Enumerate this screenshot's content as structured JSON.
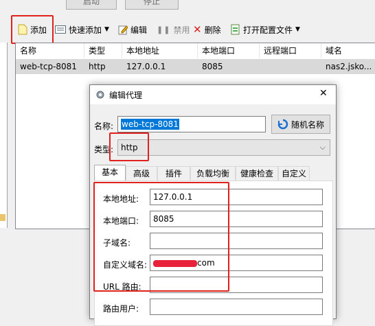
{
  "top_buttons": {
    "start": "启动",
    "stop": "停止"
  },
  "toolbar": {
    "add": "添加",
    "quick_add": "快速添加",
    "edit": "编辑",
    "disable": "禁用",
    "delete": "删除",
    "open_config": "打开配置文件"
  },
  "table": {
    "columns": [
      "名称",
      "类型",
      "本地地址",
      "本地端口",
      "远程端口",
      "域名"
    ],
    "rows": [
      {
        "name": "web-tcp-8081",
        "type": "http",
        "local_addr": "127.0.0.1",
        "local_port": "8085",
        "remote_port": "",
        "domain": "nas2.jsko..."
      }
    ]
  },
  "dialog": {
    "title": "编辑代理",
    "close": "✕",
    "name_label": "名称:",
    "name_value": "web-tcp-8081",
    "random_name_button": "随机名称",
    "type_label": "类型:",
    "type_value": "http",
    "tabs": [
      "基本",
      "高级",
      "插件",
      "负载均衡",
      "健康检查",
      "自定义"
    ],
    "fields": {
      "local_addr_label": "本地地址:",
      "local_addr_value": "127.0.0.1",
      "local_port_label": "本地端口:",
      "local_port_value": "8085",
      "subdomain_label": "子域名:",
      "subdomain_value": "",
      "custom_domain_label": "自定义域名:",
      "custom_domain_value": "com",
      "url_route_label": "URL 路由:",
      "url_route_value": "",
      "route_user_label": "路由用户:",
      "route_user_value": ""
    }
  },
  "colors": {
    "highlight_red": "#e0201a",
    "selection_blue": "#0078d7"
  }
}
